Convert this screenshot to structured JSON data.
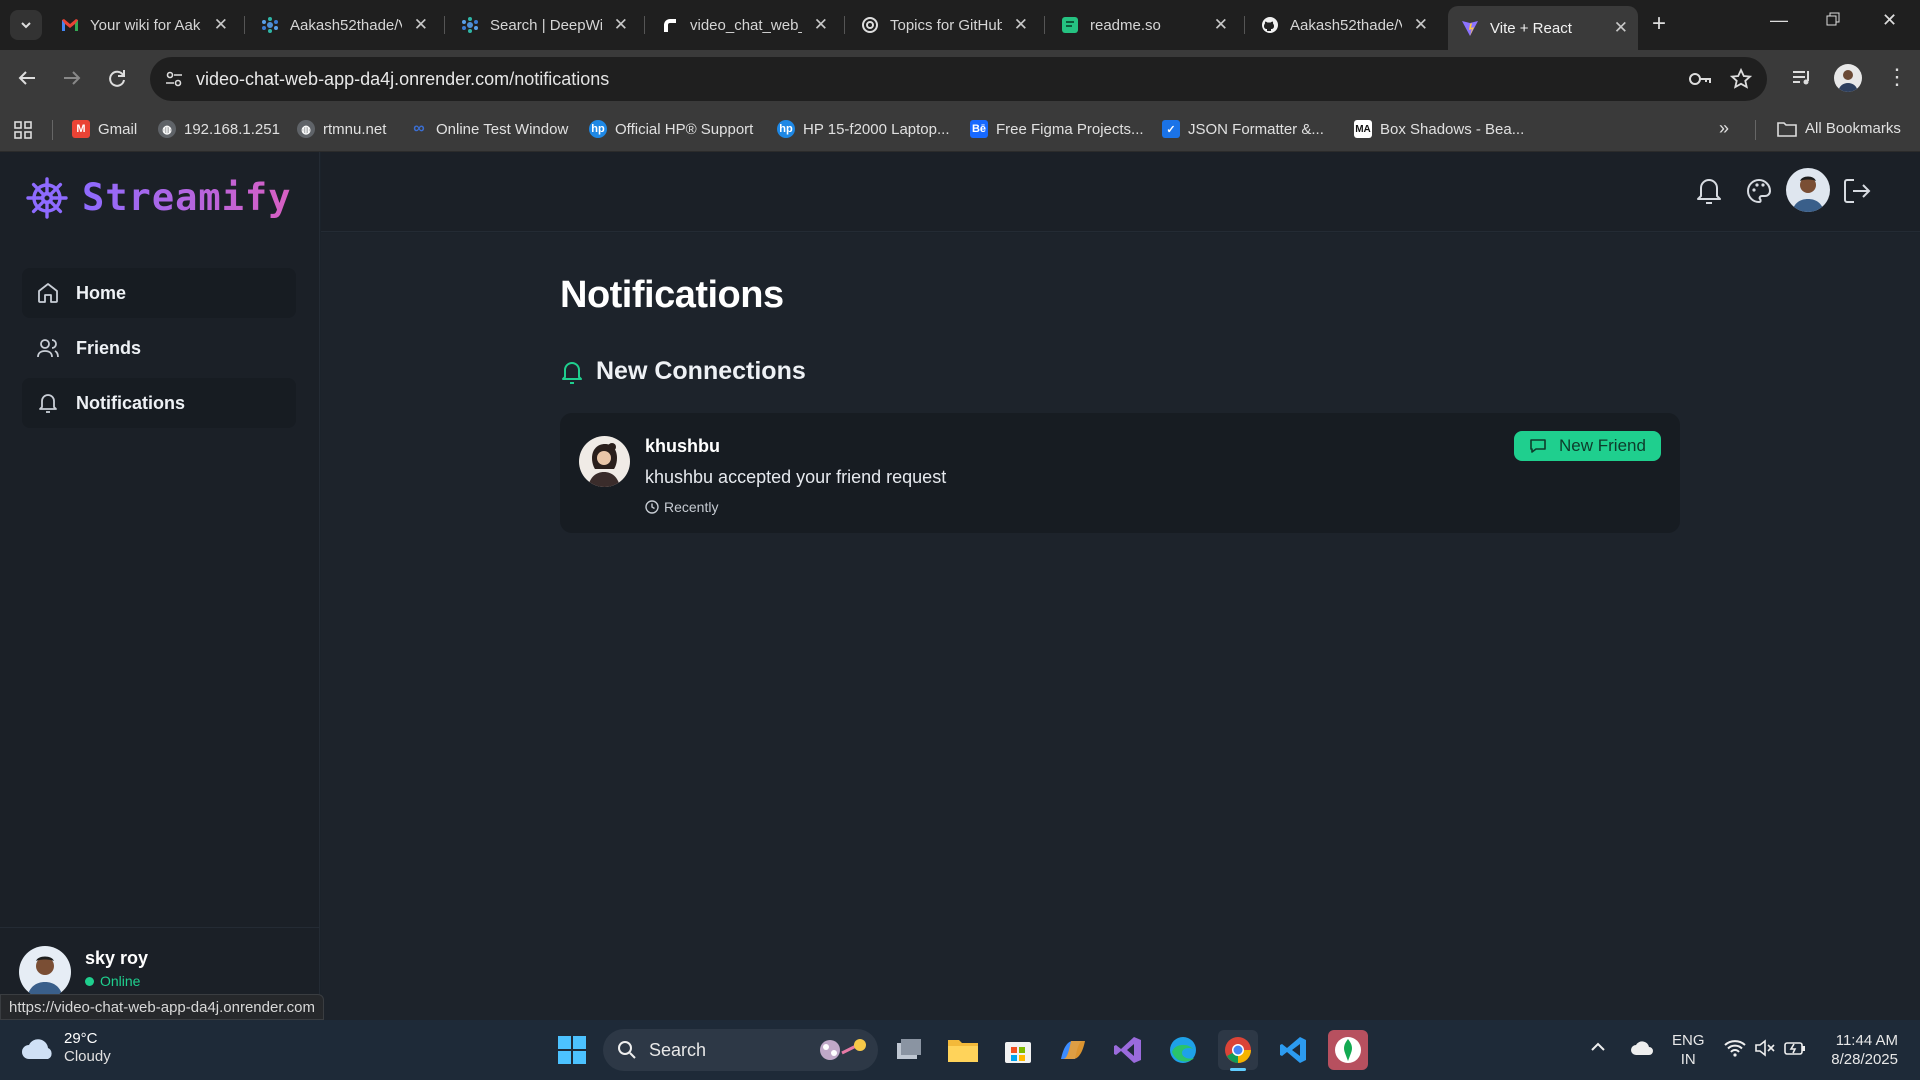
{
  "browser": {
    "tabs": [
      {
        "title": "Your wiki for Aak",
        "icon": "gmail-icon"
      },
      {
        "title": "Aakash52thade/V",
        "icon": "deepwiki-icon"
      },
      {
        "title": "Search | DeepWiki",
        "icon": "deepwiki-icon"
      },
      {
        "title": "video_chat_web_",
        "icon": "render-icon"
      },
      {
        "title": "Topics for GitHub",
        "icon": "openai-icon"
      },
      {
        "title": "readme.so",
        "icon": "readme-icon"
      },
      {
        "title": "Aakash52thade/V",
        "icon": "github-icon"
      },
      {
        "title": "Vite + React",
        "icon": "vite-icon",
        "active": true
      }
    ],
    "url_host": "video-chat-web-app-da4j.onrender.com",
    "url_path": "/notifications",
    "bookmarks": [
      {
        "label": "Gmail",
        "color": "#ea4335"
      },
      {
        "label": "192.168.1.251",
        "color": "#9aa0a6"
      },
      {
        "label": "rtmnu.net",
        "color": "#9aa0a6"
      },
      {
        "label": "Online Test Window",
        "color": "#3b6fd4"
      },
      {
        "label": "Official HP® Support",
        "color": "#1e88e5"
      },
      {
        "label": "HP 15-f2000 Laptop...",
        "color": "#1e88e5"
      },
      {
        "label": "Free Figma Projects...",
        "color": "#1769ff"
      },
      {
        "label": "JSON Formatter &...",
        "color": "#1a73e8"
      },
      {
        "label": "Box Shadows - Bea...",
        "color": "#222222"
      }
    ],
    "all_bookmarks": "All Bookmarks",
    "status_url": "https://video-chat-web-app-da4j.onrender.com"
  },
  "app": {
    "brand": "Streamify",
    "nav": [
      {
        "label": "Home",
        "icon": "home-icon"
      },
      {
        "label": "Friends",
        "icon": "users-icon"
      },
      {
        "label": "Notifications",
        "icon": "bell-icon"
      }
    ],
    "user": {
      "name": "sky roy",
      "status": "Online"
    },
    "page_title": "Notifications",
    "section_title": "New Connections",
    "notification": {
      "name": "khushbu",
      "message": "khushbu accepted your friend request",
      "time": "Recently",
      "badge": "New Friend"
    }
  },
  "taskbar": {
    "weather_temp": "29°C",
    "weather_desc": "Cloudy",
    "search_label": "Search",
    "lang_top": "ENG",
    "lang_bottom": "IN",
    "time": "11:44 AM",
    "date": "8/28/2025"
  },
  "colors": {
    "accent": "#8e6bff",
    "success": "#1fcf8e",
    "bg": "#1d232b"
  }
}
